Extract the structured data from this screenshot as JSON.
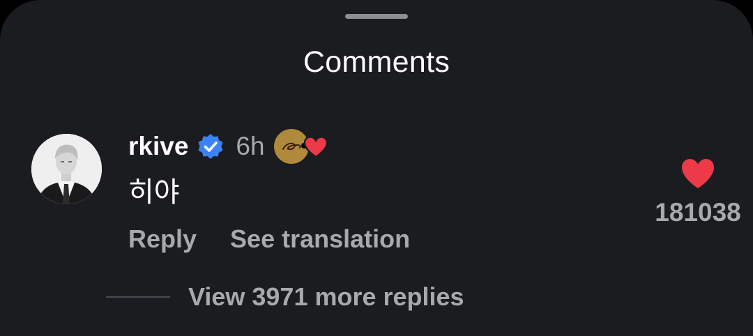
{
  "header": {
    "title": "Comments"
  },
  "comment": {
    "username": "rkive",
    "verified_icon": "verified-badge-icon",
    "timestamp": "6h",
    "creator_like_icon": "creator-liked-heart-icon",
    "text": "히야",
    "actions": {
      "reply": "Reply",
      "translate": "See translation"
    },
    "like": {
      "icon": "heart-icon",
      "color": "#ec3a48",
      "count": "181038"
    },
    "replies": {
      "label": "View 3971 more replies"
    }
  },
  "colors": {
    "background": "#1b1c20",
    "primary_text": "#ffffff",
    "secondary_text": "#a8a9ad",
    "verified_blue": "#3b82f6",
    "heart_red": "#ec3a48"
  }
}
